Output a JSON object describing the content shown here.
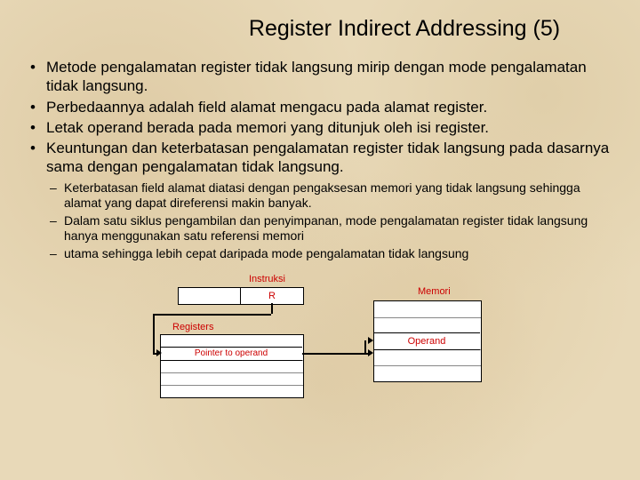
{
  "title": "Register Indirect Addressing (5)",
  "bullets": {
    "b1": "Metode pengalamatan register tidak langsung mirip dengan mode pengalamatan tidak langsung.",
    "b2": "Perbedaannya adalah field alamat mengacu pada alamat register.",
    "b3": "Letak operand berada pada memori yang ditunjuk oleh isi register.",
    "b4": "Keuntungan dan keterbatasan pengalamatan register tidak langsung pada dasarnya sama dengan pengalamatan tidak langsung.",
    "sub": {
      "s1": "Keterbatasan field alamat diatasi dengan pengaksesan memori yang tidak langsung sehingga alamat yang dapat direferensi makin banyak.",
      "s2": "Dalam satu siklus pengambilan dan penyimpanan, mode pengalamatan register tidak langsung hanya menggunakan satu referensi memori",
      "s3": "utama sehingga lebih cepat daripada mode pengalamatan tidak langsung"
    }
  },
  "diagram": {
    "instruksi": "Instruksi",
    "r": "R",
    "memori": "Memori",
    "registers": "Registers",
    "pointer": "Pointer to operand",
    "operand": "Operand"
  }
}
